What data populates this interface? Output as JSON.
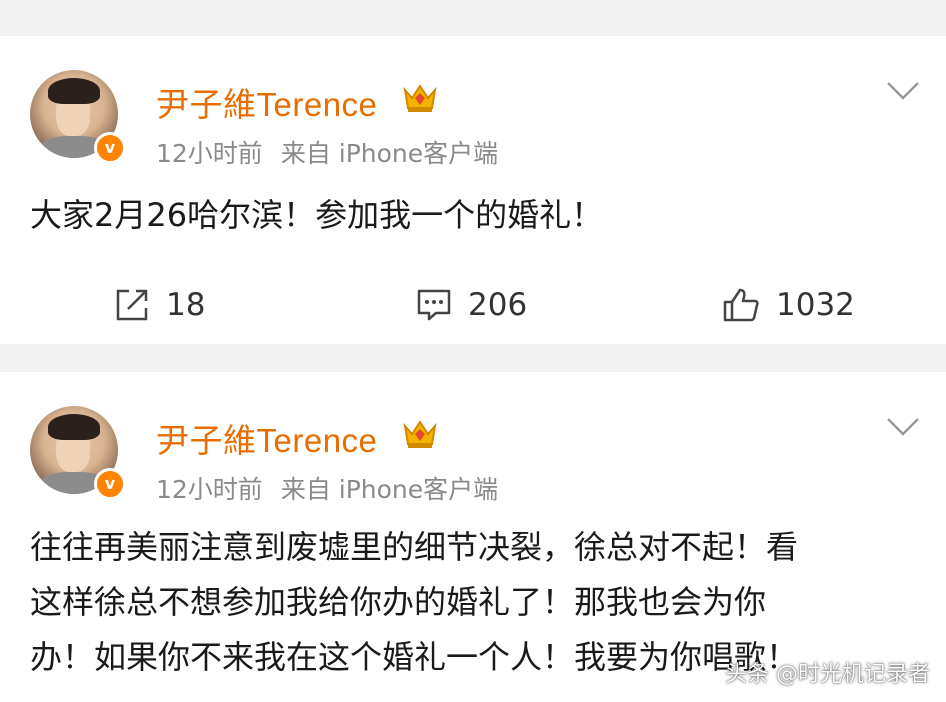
{
  "posts": [
    {
      "username": "尹子維Terence",
      "time": "12小时前",
      "source": "来自 iPhone客户端",
      "content": "大家2月26哈尔滨！参加我一个的婚礼！",
      "shares": "18",
      "comments": "206",
      "likes": "1032"
    },
    {
      "username": "尹子維Terence",
      "time": "12小时前",
      "source": "来自 iPhone客户端",
      "content_lines": [
        "往往再美丽注意到废墟里的细节决裂，徐总对不起！看",
        "这样徐总不想参加我给你办的婚礼了！那我也会为你",
        "办！如果你不来我在这个婚礼一个人！我要为你唱歌！"
      ]
    }
  ],
  "watermark": "头条 @时光机记录者",
  "colors": {
    "username": "#e86e00",
    "meta": "#8a8a8a",
    "verified": "#ff8200",
    "background": "#f2f2f2"
  },
  "icons": {
    "verified": "verified-v-badge",
    "crown": "crown-icon",
    "chevron": "chevron-down-icon",
    "share": "share-icon",
    "comment": "comment-icon",
    "like": "thumbs-up-icon"
  }
}
